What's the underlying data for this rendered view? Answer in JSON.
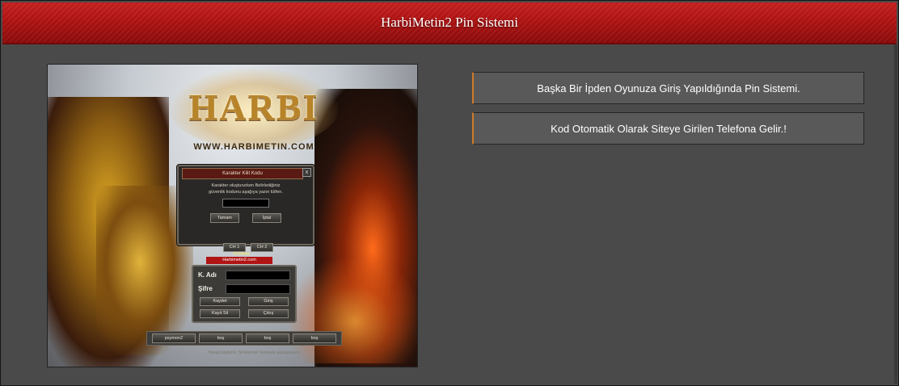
{
  "header": {
    "title": "HarbiMetin2 Pin Sistemi"
  },
  "screenshot": {
    "logo": {
      "text": "HARBI",
      "url": "WWW.HARBIMETIN.COM"
    },
    "pin_dialog": {
      "title": "Karakter Kilit Kodu",
      "close": "x",
      "text_line1": "Karakter oluştururken Belirlediğiniz",
      "text_line2": "güvenlik kodunu aşağıya yazın lütfen.",
      "ok": "Tamam",
      "cancel": "İptal"
    },
    "channels": [
      "CH 1",
      "CH 2"
    ],
    "status": "NORMAL",
    "banner": "Harbimetin2.com",
    "login": {
      "user_label": "K. Adı",
      "pass_label": "Şifre",
      "save": "Kaydet",
      "enter": "Giriş",
      "delete": "Kayıt Sil",
      "exit": "Çıkış"
    },
    "accounts": [
      "psymon2",
      "boş",
      "boş",
      "boş"
    ],
    "footnote": "Hesap bilgilerini 'Şifrelerinizi' kimseyle paylaşmayın"
  },
  "info": {
    "line1": "Başka Bir İpden Oyunuza Giriş Yapıldığında Pin Sistemi.",
    "line2": "Kod Otomatik Olarak Siteye Girilen Telefona Gelir.!"
  },
  "colors": {
    "header_red": "#b31414",
    "panel_gray": "#4a4a4a",
    "info_box": "#595959",
    "accent": "#d07a2a"
  }
}
